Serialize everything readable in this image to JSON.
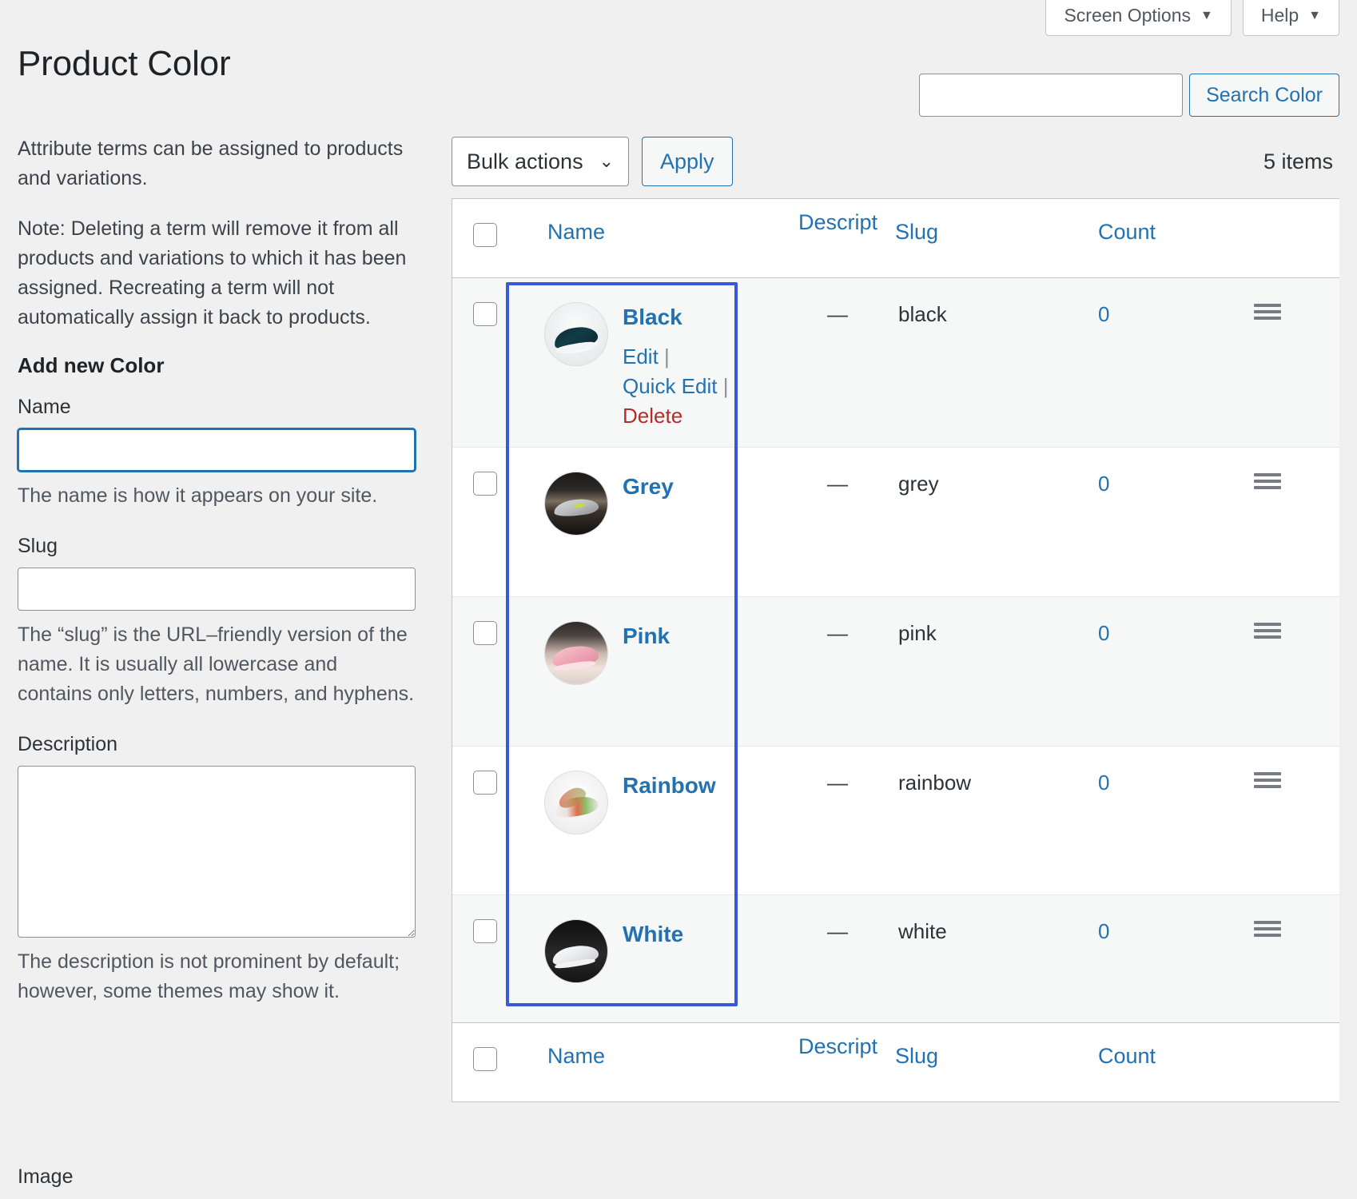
{
  "screen_meta": {
    "screen_options_label": "Screen Options",
    "help_label": "Help",
    "caret_glyph": "▼"
  },
  "header": {
    "page_title": "Product Color"
  },
  "search": {
    "value": "",
    "placeholder": "",
    "button_label": "Search Color"
  },
  "left_panel": {
    "intro_paragraph": "Attribute terms can be assigned to products and variations.",
    "note_paragraph": "Note: Deleting a term will remove it from all products and variations to which it has been assigned. Recreating a term will not automatically assign it back to products.",
    "form_heading": "Add new Color",
    "name_label": "Name",
    "name_value": "",
    "name_help": "The name is how it appears on your site.",
    "slug_label": "Slug",
    "slug_value": "",
    "slug_help": "The “slug” is the URL–friendly version of the name. It is usually all lowercase and contains only letters, numbers, and hyphens.",
    "description_label": "Description",
    "description_value": "",
    "description_help": "The description is not prominent by default; however, some themes may show it.",
    "image_label": "Image"
  },
  "tablenav": {
    "bulk_actions_label": "Bulk actions",
    "bulk_caret": "⌄",
    "apply_label": "Apply",
    "items_count": "5 items"
  },
  "table": {
    "columns": {
      "name": "Name",
      "description": "Description",
      "slug": "Slug",
      "count": "Count"
    },
    "row_actions": {
      "edit": "Edit",
      "quick_edit": "Quick Edit",
      "delete": "Delete",
      "separator": "|"
    },
    "empty_description": "—",
    "rows": [
      {
        "name": "Black",
        "thumb": "sneaker-black-thumbnail",
        "description": "—",
        "slug": "black",
        "count": "0",
        "show_actions": true
      },
      {
        "name": "Grey",
        "thumb": "sneaker-grey-thumbnail",
        "description": "—",
        "slug": "grey",
        "count": "0",
        "show_actions": false
      },
      {
        "name": "Pink",
        "thumb": "sneaker-pink-thumbnail",
        "description": "—",
        "slug": "pink",
        "count": "0",
        "show_actions": false
      },
      {
        "name": "Rainbow",
        "thumb": "sneaker-rainbow-thumbnail",
        "description": "—",
        "slug": "rainbow",
        "count": "0",
        "show_actions": false
      },
      {
        "name": "White",
        "thumb": "sneaker-white-thumbnail",
        "description": "—",
        "slug": "white",
        "count": "0",
        "show_actions": false
      }
    ]
  },
  "colors": {
    "link_blue": "#2271b1",
    "delete_red": "#b32d2e",
    "highlight_border": "#3858d6",
    "page_background": "#f0f0f1",
    "row_alt_background": "#f6f7f7"
  }
}
